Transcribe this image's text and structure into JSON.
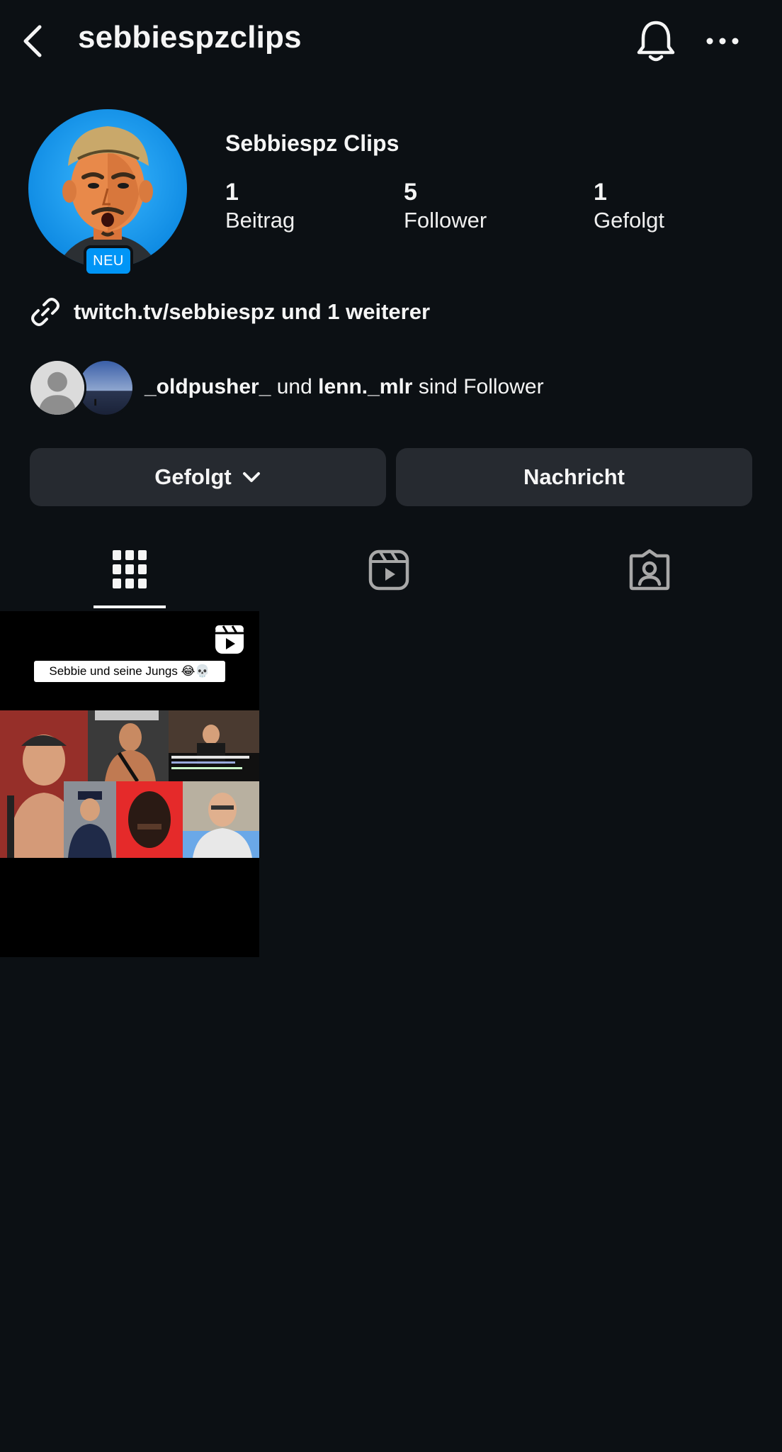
{
  "header": {
    "username": "sebbiespzclips",
    "back_icon": "chevron-left-icon",
    "bell_icon": "bell-icon",
    "more_icon": "ellipsis-icon"
  },
  "profile": {
    "display_name": "Sebbiespz Clips",
    "avatar_badge": "NEU",
    "stats": [
      {
        "count": "1",
        "label": "Beitrag"
      },
      {
        "count": "5",
        "label": "Follower"
      },
      {
        "count": "1",
        "label": "Gefolgt"
      }
    ],
    "link_text": "twitch.tv/sebbiespz und 1 weiterer",
    "mutual": {
      "user1": "_oldpusher_",
      "connector": " und ",
      "user2": "lenn._mlr",
      "suffix": " sind Follower"
    }
  },
  "actions": {
    "follow_label": "Gefolgt",
    "message_label": "Nachricht"
  },
  "tabs": [
    {
      "icon": "grid-icon",
      "active": true
    },
    {
      "icon": "reels-icon",
      "active": false
    },
    {
      "icon": "tagged-icon",
      "active": false
    }
  ],
  "posts": [
    {
      "caption": "Sebbie und seine Jungs 😂💀",
      "type": "reel"
    }
  ],
  "colors": {
    "background": "#0c1014",
    "button": "#262a30",
    "accent": "#0095f6",
    "text": "#f5f5f5"
  }
}
